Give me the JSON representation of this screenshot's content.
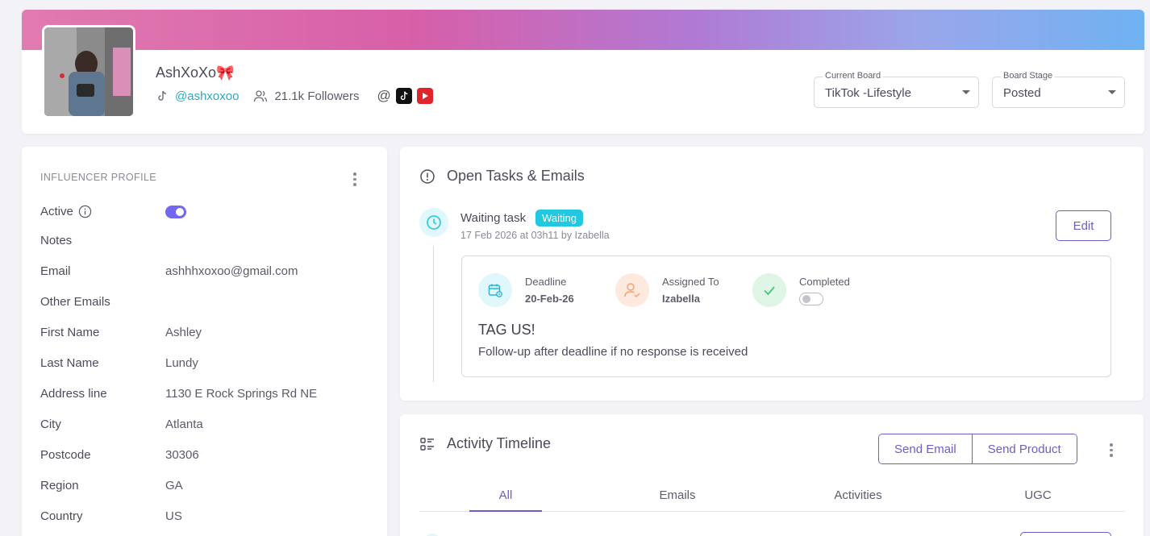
{
  "profile": {
    "name": "AshXoXo🎀",
    "handle": "@ashxoxoo",
    "followers": "21.1k Followers",
    "at_symbol": "@"
  },
  "current_board": {
    "label": "Current Board",
    "value": "TikTok -Lifestyle"
  },
  "board_stage": {
    "label": "Board Stage",
    "value": "Posted"
  },
  "influencer_profile": {
    "title": "INFLUENCER PROFILE",
    "active_label": "Active",
    "active": true,
    "fields": [
      {
        "key": "Notes",
        "value": ""
      },
      {
        "key": "Email",
        "value": "ashhhxoxoo@gmail.com"
      },
      {
        "key": "Other Emails",
        "value": ""
      },
      {
        "key": "First Name",
        "value": "Ashley"
      },
      {
        "key": "Last Name",
        "value": "Lundy"
      },
      {
        "key": "Address line",
        "value": "1130 E Rock Springs Rd NE"
      },
      {
        "key": "City",
        "value": "Atlanta"
      },
      {
        "key": "Postcode",
        "value": "30306"
      },
      {
        "key": "Region",
        "value": "GA"
      },
      {
        "key": "Country",
        "value": "US"
      }
    ]
  },
  "tasks": {
    "title": "Open Tasks & Emails",
    "task": {
      "title": "Waiting task",
      "status": "Waiting",
      "meta": "17 Feb 2026 at 03h11 by Izabella",
      "edit_label": "Edit",
      "deadline_label": "Deadline",
      "deadline_value": "20-Feb-26",
      "assigned_label": "Assigned To",
      "assigned_value": "Izabella",
      "completed_label": "Completed",
      "completed": false,
      "heading": "TAG US!",
      "description": "Follow-up after deadline if no response is received"
    }
  },
  "activity": {
    "title": "Activity Timeline",
    "send_email": "Send Email",
    "send_product": "Send Product",
    "tabs": [
      "All",
      "Emails",
      "Activities",
      "UGC"
    ],
    "active_tab": "All"
  },
  "colors": {
    "accent": "#6a5fc4",
    "toggle_on": "#7367f0",
    "status_waiting": "#22c7e0",
    "link": "#2aa9c9"
  }
}
